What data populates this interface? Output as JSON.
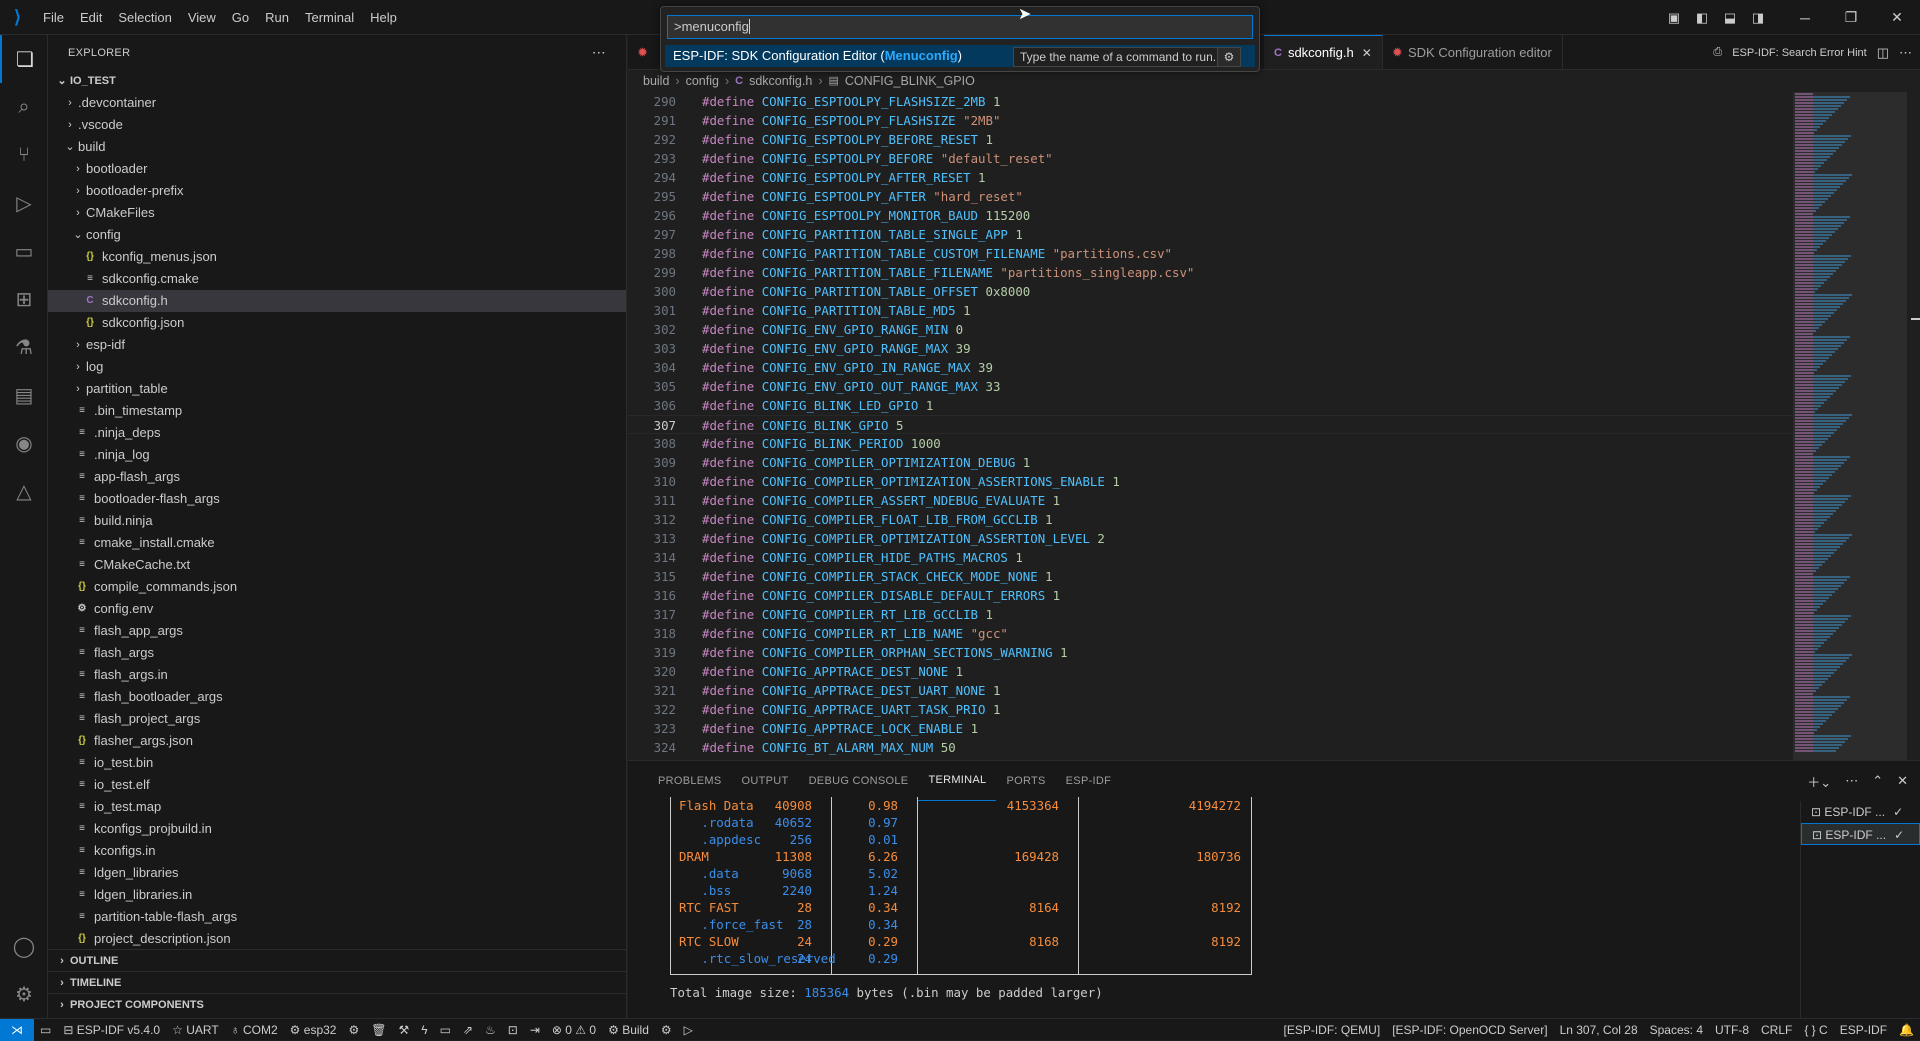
{
  "menu": [
    "File",
    "Edit",
    "Selection",
    "View",
    "Go",
    "Run",
    "Terminal",
    "Help"
  ],
  "quickpick": {
    "input": ">menuconfig",
    "item_prefix": "ESP-IDF: SDK Configuration Editor (",
    "item_highlight": "Menuconfig",
    "item_suffix": ")",
    "tooltip": "Type the name of a command to run."
  },
  "sidebar": {
    "header": "EXPLORER",
    "root": "IO_TEST",
    "tree": [
      {
        "label": ".devcontainer",
        "type": "folder",
        "depth": 1,
        "open": false
      },
      {
        "label": ".vscode",
        "type": "folder",
        "depth": 1,
        "open": false
      },
      {
        "label": "build",
        "type": "folder",
        "depth": 1,
        "open": true
      },
      {
        "label": "bootloader",
        "type": "folder",
        "depth": 2,
        "open": false
      },
      {
        "label": "bootloader-prefix",
        "type": "folder",
        "depth": 2,
        "open": false
      },
      {
        "label": "CMakeFiles",
        "type": "folder",
        "depth": 2,
        "open": false
      },
      {
        "label": "config",
        "type": "folder",
        "depth": 2,
        "open": true
      },
      {
        "label": "kconfig_menus.json",
        "type": "json",
        "depth": 3
      },
      {
        "label": "sdkconfig.cmake",
        "type": "txt",
        "depth": 3
      },
      {
        "label": "sdkconfig.h",
        "type": "c",
        "depth": 3,
        "selected": true
      },
      {
        "label": "sdkconfig.json",
        "type": "json",
        "depth": 3
      },
      {
        "label": "esp-idf",
        "type": "folder",
        "depth": 2,
        "open": false
      },
      {
        "label": "log",
        "type": "folder",
        "depth": 2,
        "open": false
      },
      {
        "label": "partition_table",
        "type": "folder",
        "depth": 2,
        "open": false
      },
      {
        "label": ".bin_timestamp",
        "type": "txt",
        "depth": 2
      },
      {
        "label": ".ninja_deps",
        "type": "txt",
        "depth": 2
      },
      {
        "label": ".ninja_log",
        "type": "txt",
        "depth": 2
      },
      {
        "label": "app-flash_args",
        "type": "txt",
        "depth": 2
      },
      {
        "label": "bootloader-flash_args",
        "type": "txt",
        "depth": 2
      },
      {
        "label": "build.ninja",
        "type": "txt",
        "depth": 2
      },
      {
        "label": "cmake_install.cmake",
        "type": "txt",
        "depth": 2
      },
      {
        "label": "CMakeCache.txt",
        "type": "txt",
        "depth": 2
      },
      {
        "label": "compile_commands.json",
        "type": "json",
        "depth": 2
      },
      {
        "label": "config.env",
        "type": "gear",
        "depth": 2
      },
      {
        "label": "flash_app_args",
        "type": "txt",
        "depth": 2
      },
      {
        "label": "flash_args",
        "type": "txt",
        "depth": 2
      },
      {
        "label": "flash_args.in",
        "type": "txt",
        "depth": 2
      },
      {
        "label": "flash_bootloader_args",
        "type": "txt",
        "depth": 2
      },
      {
        "label": "flash_project_args",
        "type": "txt",
        "depth": 2
      },
      {
        "label": "flasher_args.json",
        "type": "json",
        "depth": 2
      },
      {
        "label": "io_test.bin",
        "type": "txt",
        "depth": 2
      },
      {
        "label": "io_test.elf",
        "type": "txt",
        "depth": 2
      },
      {
        "label": "io_test.map",
        "type": "txt",
        "depth": 2
      },
      {
        "label": "kconfigs_projbuild.in",
        "type": "txt",
        "depth": 2
      },
      {
        "label": "kconfigs.in",
        "type": "txt",
        "depth": 2
      },
      {
        "label": "ldgen_libraries",
        "type": "txt",
        "depth": 2
      },
      {
        "label": "ldgen_libraries.in",
        "type": "txt",
        "depth": 2
      },
      {
        "label": "partition-table-flash_args",
        "type": "txt",
        "depth": 2
      },
      {
        "label": "project_description.json",
        "type": "json",
        "depth": 2
      }
    ],
    "sections": [
      "OUTLINE",
      "TIMELINE",
      "PROJECT COMPONENTS"
    ]
  },
  "tabs": [
    {
      "label": "sdkconfig.h",
      "icon": "C",
      "active": true
    },
    {
      "label": "SDK Configuration editor",
      "icon": "✹",
      "active": false
    }
  ],
  "tab_actions": {
    "search_error": "ESP-IDF: Search Error Hint"
  },
  "breadcrumbs": [
    "build",
    "config",
    "sdkconfig.h",
    "CONFIG_BLINK_GPIO"
  ],
  "code": {
    "current_line": 307,
    "lines": [
      {
        "n": 290,
        "macro": "CONFIG_ESPTOOLPY_FLASHSIZE_2MB",
        "value": "1",
        "vtype": "num"
      },
      {
        "n": 291,
        "macro": "CONFIG_ESPTOOLPY_FLASHSIZE",
        "value": "\"2MB\"",
        "vtype": "str"
      },
      {
        "n": 292,
        "macro": "CONFIG_ESPTOOLPY_BEFORE_RESET",
        "value": "1",
        "vtype": "num"
      },
      {
        "n": 293,
        "macro": "CONFIG_ESPTOOLPY_BEFORE",
        "value": "\"default_reset\"",
        "vtype": "str"
      },
      {
        "n": 294,
        "macro": "CONFIG_ESPTOOLPY_AFTER_RESET",
        "value": "1",
        "vtype": "num"
      },
      {
        "n": 295,
        "macro": "CONFIG_ESPTOOLPY_AFTER",
        "value": "\"hard_reset\"",
        "vtype": "str"
      },
      {
        "n": 296,
        "macro": "CONFIG_ESPTOOLPY_MONITOR_BAUD",
        "value": "115200",
        "vtype": "num"
      },
      {
        "n": 297,
        "macro": "CONFIG_PARTITION_TABLE_SINGLE_APP",
        "value": "1",
        "vtype": "num"
      },
      {
        "n": 298,
        "macro": "CONFIG_PARTITION_TABLE_CUSTOM_FILENAME",
        "value": "\"partitions.csv\"",
        "vtype": "str"
      },
      {
        "n": 299,
        "macro": "CONFIG_PARTITION_TABLE_FILENAME",
        "value": "\"partitions_singleapp.csv\"",
        "vtype": "str"
      },
      {
        "n": 300,
        "macro": "CONFIG_PARTITION_TABLE_OFFSET",
        "value": "0x8000",
        "vtype": "num"
      },
      {
        "n": 301,
        "macro": "CONFIG_PARTITION_TABLE_MD5",
        "value": "1",
        "vtype": "num"
      },
      {
        "n": 302,
        "macro": "CONFIG_ENV_GPIO_RANGE_MIN",
        "value": "0",
        "vtype": "num"
      },
      {
        "n": 303,
        "macro": "CONFIG_ENV_GPIO_RANGE_MAX",
        "value": "39",
        "vtype": "num"
      },
      {
        "n": 304,
        "macro": "CONFIG_ENV_GPIO_IN_RANGE_MAX",
        "value": "39",
        "vtype": "num"
      },
      {
        "n": 305,
        "macro": "CONFIG_ENV_GPIO_OUT_RANGE_MAX",
        "value": "33",
        "vtype": "num"
      },
      {
        "n": 306,
        "macro": "CONFIG_BLINK_LED_GPIO",
        "value": "1",
        "vtype": "num"
      },
      {
        "n": 307,
        "macro": "CONFIG_BLINK_GPIO",
        "value": "5",
        "vtype": "num"
      },
      {
        "n": 308,
        "macro": "CONFIG_BLINK_PERIOD",
        "value": "1000",
        "vtype": "num"
      },
      {
        "n": 309,
        "macro": "CONFIG_COMPILER_OPTIMIZATION_DEBUG",
        "value": "1",
        "vtype": "num"
      },
      {
        "n": 310,
        "macro": "CONFIG_COMPILER_OPTIMIZATION_ASSERTIONS_ENABLE",
        "value": "1",
        "vtype": "num"
      },
      {
        "n": 311,
        "macro": "CONFIG_COMPILER_ASSERT_NDEBUG_EVALUATE",
        "value": "1",
        "vtype": "num"
      },
      {
        "n": 312,
        "macro": "CONFIG_COMPILER_FLOAT_LIB_FROM_GCCLIB",
        "value": "1",
        "vtype": "num"
      },
      {
        "n": 313,
        "macro": "CONFIG_COMPILER_OPTIMIZATION_ASSERTION_LEVEL",
        "value": "2",
        "vtype": "num"
      },
      {
        "n": 314,
        "macro": "CONFIG_COMPILER_HIDE_PATHS_MACROS",
        "value": "1",
        "vtype": "num"
      },
      {
        "n": 315,
        "macro": "CONFIG_COMPILER_STACK_CHECK_MODE_NONE",
        "value": "1",
        "vtype": "num"
      },
      {
        "n": 316,
        "macro": "CONFIG_COMPILER_DISABLE_DEFAULT_ERRORS",
        "value": "1",
        "vtype": "num"
      },
      {
        "n": 317,
        "macro": "CONFIG_COMPILER_RT_LIB_GCCLIB",
        "value": "1",
        "vtype": "num"
      },
      {
        "n": 318,
        "macro": "CONFIG_COMPILER_RT_LIB_NAME",
        "value": "\"gcc\"",
        "vtype": "str"
      },
      {
        "n": 319,
        "macro": "CONFIG_COMPILER_ORPHAN_SECTIONS_WARNING",
        "value": "1",
        "vtype": "num"
      },
      {
        "n": 320,
        "macro": "CONFIG_APPTRACE_DEST_NONE",
        "value": "1",
        "vtype": "num"
      },
      {
        "n": 321,
        "macro": "CONFIG_APPTRACE_DEST_UART_NONE",
        "value": "1",
        "vtype": "num"
      },
      {
        "n": 322,
        "macro": "CONFIG_APPTRACE_UART_TASK_PRIO",
        "value": "1",
        "vtype": "num"
      },
      {
        "n": 323,
        "macro": "CONFIG_APPTRACE_LOCK_ENABLE",
        "value": "1",
        "vtype": "num"
      },
      {
        "n": 324,
        "macro": "CONFIG_BT_ALARM_MAX_NUM",
        "value": "50",
        "vtype": "num"
      }
    ]
  },
  "panel": {
    "tabs": [
      "PROBLEMS",
      "OUTPUT",
      "DEBUG CONSOLE",
      "TERMINAL",
      "PORTS",
      "ESP-IDF"
    ],
    "active_tab": "TERMINAL",
    "terminals": [
      "ESP-IDF ...",
      "ESP-IDF ..."
    ],
    "size_rows": [
      {
        "name": "Flash Data",
        "kind": "orange",
        "used": "40908",
        "pct": "0.98",
        "remain": "4153364",
        "total": "4194272"
      },
      {
        "name": "   .rodata",
        "kind": "blue",
        "used": "40652",
        "pct": "0.97",
        "remain": "",
        "total": ""
      },
      {
        "name": "   .appdesc",
        "kind": "blue",
        "used": "256",
        "pct": "0.01",
        "remain": "",
        "total": ""
      },
      {
        "name": "DRAM",
        "kind": "orange",
        "used": "11308",
        "pct": "6.26",
        "remain": "169428",
        "total": "180736"
      },
      {
        "name": "   .data",
        "kind": "blue",
        "used": "9068",
        "pct": "5.02",
        "remain": "",
        "total": ""
      },
      {
        "name": "   .bss",
        "kind": "blue",
        "used": "2240",
        "pct": "1.24",
        "remain": "",
        "total": ""
      },
      {
        "name": "RTC FAST",
        "kind": "orange",
        "used": "28",
        "pct": "0.34",
        "remain": "8164",
        "total": "8192"
      },
      {
        "name": "   .force_fast",
        "kind": "blue",
        "used": "28",
        "pct": "0.34",
        "remain": "",
        "total": ""
      },
      {
        "name": "RTC SLOW",
        "kind": "orange",
        "used": "24",
        "pct": "0.29",
        "remain": "8168",
        "total": "8192"
      },
      {
        "name": "   .rtc_slow_reserved",
        "kind": "blue",
        "used": "24",
        "pct": "0.29",
        "remain": "",
        "total": ""
      }
    ],
    "total_prefix": "Total image size: ",
    "total_value": "185364",
    "total_suffix": " bytes (.bin may be padded larger)"
  },
  "status": {
    "left": [
      "ESP-IDF v5.4.0",
      "UART",
      "COM2",
      "esp32",
      "Build"
    ],
    "problems": "0",
    "warnings": "0",
    "right": [
      "[ESP-IDF: QEMU]",
      "[ESP-IDF: OpenOCD Server]",
      "Ln 307, Col 28",
      "Spaces: 4",
      "UTF-8",
      "CRLF",
      "{ } C",
      "ESP-IDF"
    ]
  },
  "colors": {
    "accent": "#0078d4",
    "orange": "#f78c3b",
    "blue": "#3b8eea"
  }
}
